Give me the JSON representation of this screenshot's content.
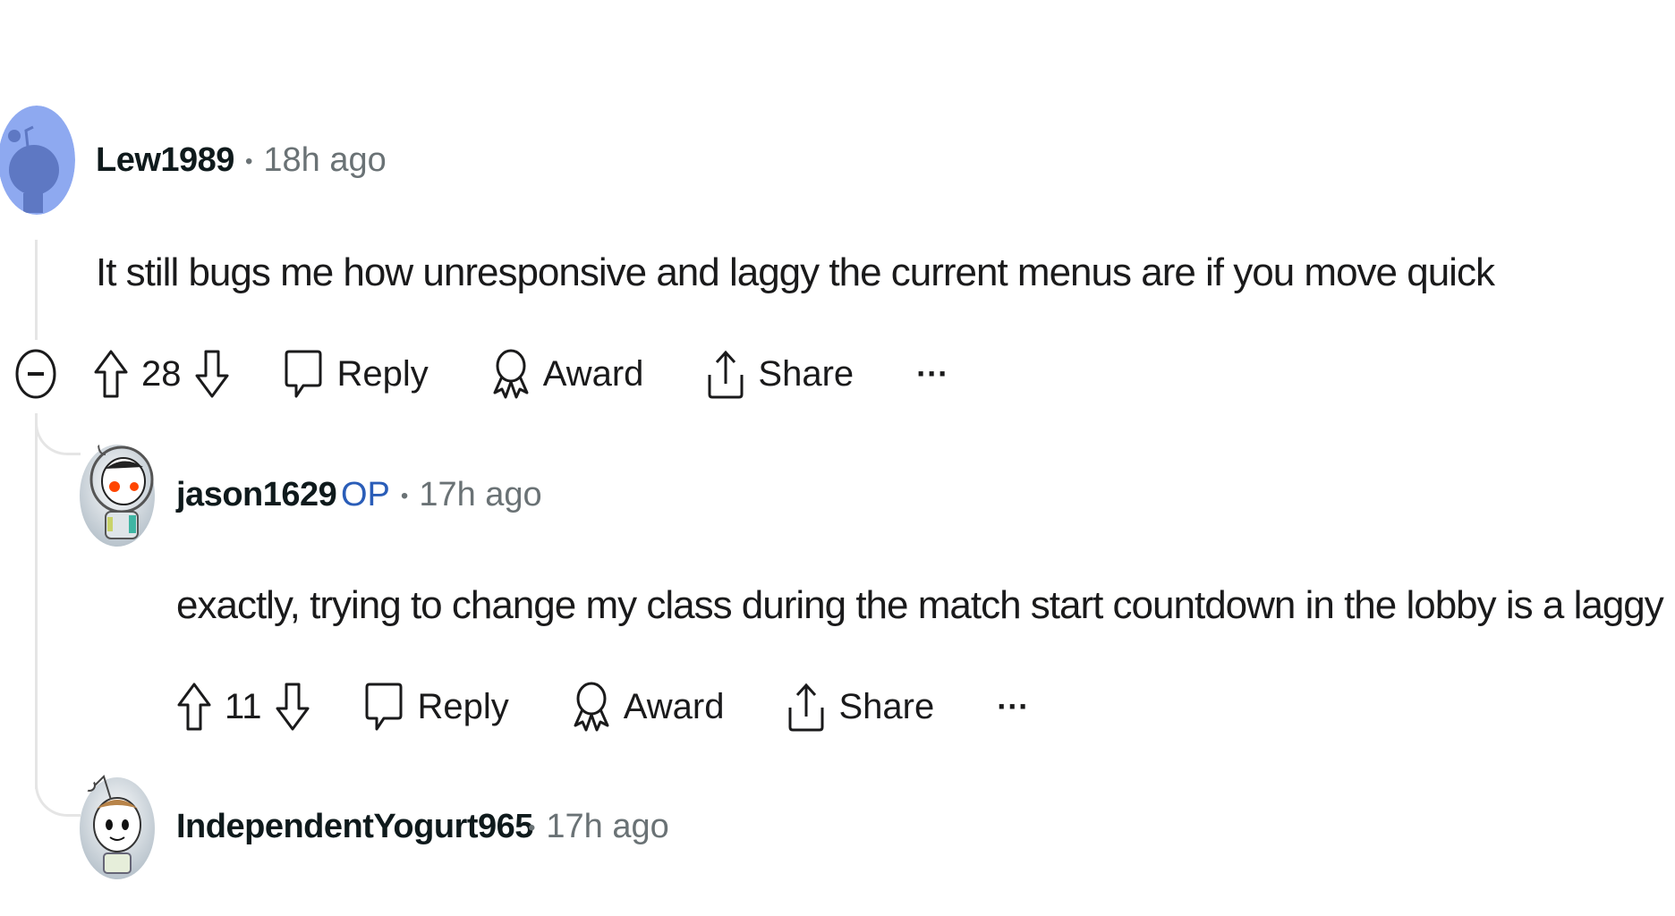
{
  "comments": [
    {
      "username": "Lew1989",
      "time": "18h ago",
      "body": "It still bugs me how unresponsive and laggy the current menus are if you move quick",
      "votes": "28",
      "actions": {
        "reply": "Reply",
        "award": "Award",
        "share": "Share",
        "more": "···"
      },
      "avatar_icon": "snoo-avatar-blue"
    },
    {
      "username": "jason1629",
      "badge": "OP",
      "time": "17h ago",
      "body": "exactly, trying to change my class during the match start countdown in the lobby is a laggy mess",
      "votes": "11",
      "actions": {
        "reply": "Reply",
        "award": "Award",
        "share": "Share",
        "more": "···"
      },
      "avatar_icon": "snoo-astronaut-avatar"
    },
    {
      "username": "IndependentYogurt965",
      "time": "17h ago",
      "avatar_icon": "snoo-avatar"
    }
  ],
  "separator": "•",
  "colors": {
    "op_badge": "#2a5db8",
    "meta": "#6a7275",
    "thread_line": "#e5e5e5",
    "avatar_blue": "#8ea9f0"
  }
}
